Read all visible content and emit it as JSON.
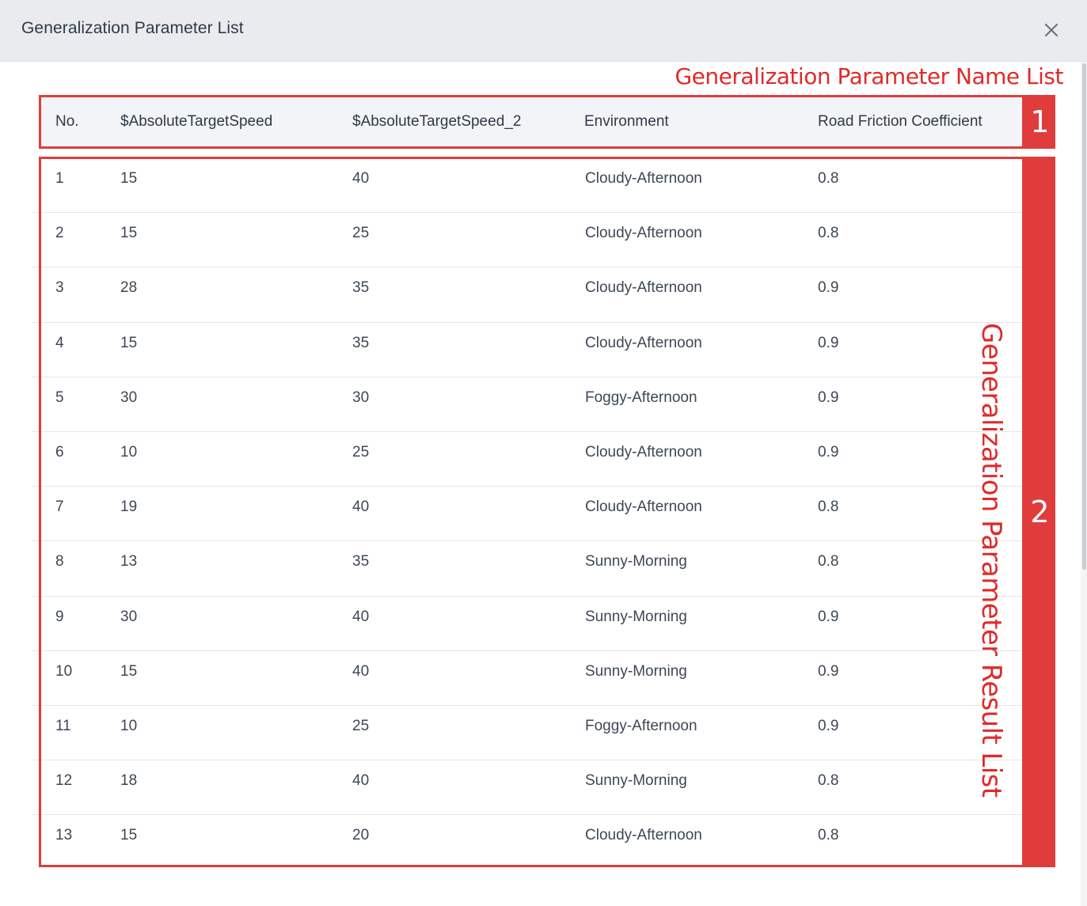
{
  "dialog": {
    "title": "Generalization Parameter List",
    "close_icon": "close-icon"
  },
  "table": {
    "columns": [
      "No.",
      "$AbsoluteTargetSpeed",
      "$AbsoluteTargetSpeed_2",
      "Environment",
      "Road Friction Coefficient"
    ],
    "rows": [
      [
        "1",
        "15",
        "40",
        "Cloudy-Afternoon",
        "0.8"
      ],
      [
        "2",
        "15",
        "25",
        "Cloudy-Afternoon",
        "0.8"
      ],
      [
        "3",
        "28",
        "35",
        "Cloudy-Afternoon",
        "0.9"
      ],
      [
        "4",
        "15",
        "35",
        "Cloudy-Afternoon",
        "0.9"
      ],
      [
        "5",
        "30",
        "30",
        "Foggy-Afternoon",
        "0.9"
      ],
      [
        "6",
        "10",
        "25",
        "Cloudy-Afternoon",
        "0.9"
      ],
      [
        "7",
        "19",
        "40",
        "Cloudy-Afternoon",
        "0.8"
      ],
      [
        "8",
        "13",
        "35",
        "Sunny-Morning",
        "0.8"
      ],
      [
        "9",
        "30",
        "40",
        "Sunny-Morning",
        "0.9"
      ],
      [
        "10",
        "15",
        "40",
        "Sunny-Morning",
        "0.9"
      ],
      [
        "11",
        "10",
        "25",
        "Foggy-Afternoon",
        "0.9"
      ],
      [
        "12",
        "18",
        "40",
        "Sunny-Morning",
        "0.8"
      ],
      [
        "13",
        "15",
        "20",
        "Cloudy-Afternoon",
        "0.8"
      ]
    ]
  },
  "annotations": {
    "name_list_label": "Generalization  Parameter Name List",
    "name_list_number": "1",
    "result_list_label": "Generalization Parameter Result List",
    "result_list_number": "2",
    "color": "#e03c3c"
  }
}
